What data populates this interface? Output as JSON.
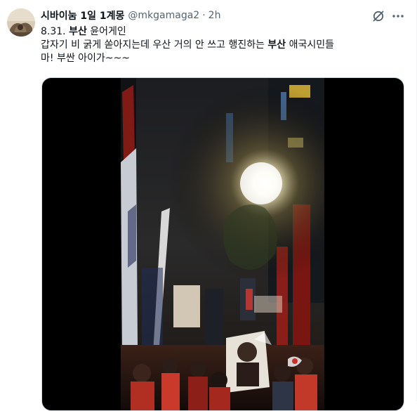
{
  "tweet": {
    "display_name": "시바이눔 1일 1계몽",
    "handle": "@mkgamaga2",
    "separator": "·",
    "time": "2h",
    "text": {
      "line1_prefix": "8.31. ",
      "line1_bold": "부산",
      "line1_suffix": " 윤어게인",
      "line2_prefix": "갑자기 비 굵게 쏟아지는데 우산 거의 안 쓰고 행진하는 ",
      "line2_bold": "부산",
      "line2_suffix": " 애국시민들",
      "line3": "마! 부싼 아이가~~~"
    }
  },
  "icons": {
    "grok": "grok-icon",
    "more": "more-dots-icon",
    "avatar": "avatar"
  },
  "colors": {
    "text_primary": "#0f1419",
    "text_secondary": "#536471",
    "media_background": "#000000",
    "border": "#cfd9de"
  }
}
